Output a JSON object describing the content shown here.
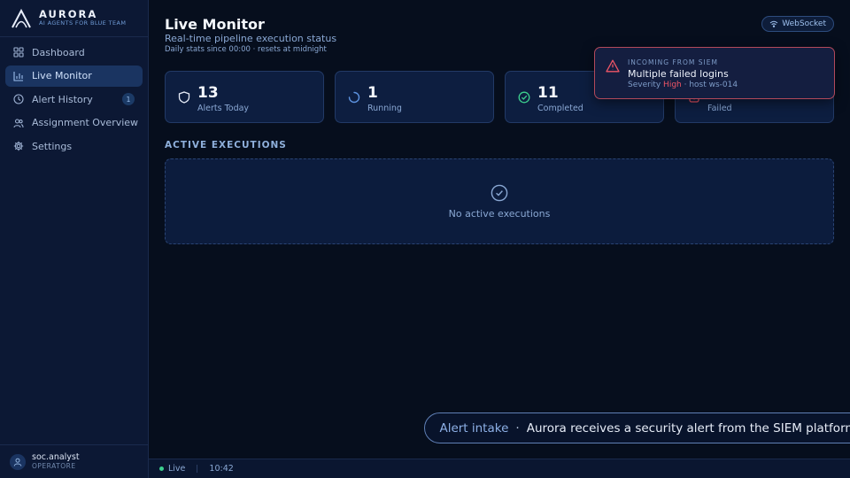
{
  "brand": {
    "name": "AURORA",
    "tagline": "AI AGENTS FOR BLUE TEAM",
    "logo_icon": "aurora-a-logo-icon"
  },
  "sidebar": {
    "items": [
      {
        "label": "Dashboard",
        "icon": "grid-icon",
        "active": false
      },
      {
        "label": "Live Monitor",
        "icon": "bar-chart-icon",
        "active": true
      },
      {
        "label": "Alert History",
        "icon": "clock-icon",
        "active": false,
        "badge": "1"
      },
      {
        "label": "Assignment Overview",
        "icon": "users-icon",
        "active": false
      },
      {
        "label": "Settings",
        "icon": "gear-icon",
        "active": false
      }
    ],
    "user": {
      "name": "soc.analyst",
      "role": "OPERATORE",
      "icon": "user-icon"
    }
  },
  "header": {
    "title": "Live Monitor",
    "subtitle": "Real-time pipeline execution status",
    "note": "Daily stats since 00:00 · resets at midnight",
    "connection_label": "WebSocket",
    "connection_icon": "wifi-icon"
  },
  "stats": [
    {
      "value": "13",
      "label": "Alerts Today",
      "icon": "shield-icon"
    },
    {
      "value": "1",
      "label": "Running",
      "icon": "spinner-icon"
    },
    {
      "value": "11",
      "label": "Completed",
      "icon": "check-circle-icon"
    },
    {
      "value": "",
      "label": "Failed",
      "icon": "alert-icon"
    }
  ],
  "active_executions": {
    "title": "ACTIVE EXECUTIONS",
    "empty_text": "No active executions",
    "empty_icon": "check-circle-icon"
  },
  "toast": {
    "kicker": "INCOMING FROM SIEM",
    "title": "Multiple failed logins",
    "severity_label": "Severity",
    "severity_value": "High",
    "host": "· host ws-014",
    "icon": "warning-triangle-icon"
  },
  "caption": {
    "step": "Alert intake",
    "separator": "·",
    "text": "Aurora receives a security alert from the SIEM platform"
  },
  "statusbar": {
    "live_label": "Live",
    "time": "10:42"
  },
  "colors": {
    "background": "#060e1d",
    "sidebar": "#0c1834",
    "accent": "#6f9bd6",
    "severity_high": "#ef5566",
    "toast_border": "#b2495b",
    "live": "#3ccf8e"
  }
}
